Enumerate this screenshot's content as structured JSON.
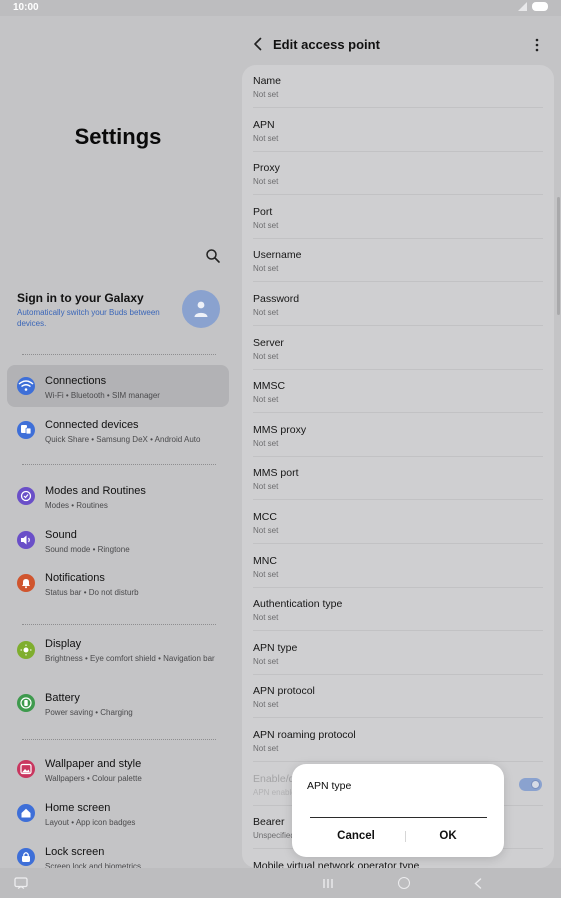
{
  "status_bar": {
    "time": "10:00"
  },
  "left_pane": {
    "title": "Settings",
    "account": {
      "title": "Sign in to your Galaxy",
      "subtitle": "Automatically switch your Buds between devices."
    },
    "menu_groups": [
      [
        {
          "label": "Connections",
          "sub": "Wi-Fi  •  Bluetooth  •  SIM manager",
          "icon": "wifi-icon",
          "color": "#3e6fd8",
          "selected": true
        },
        {
          "label": "Connected devices",
          "sub": "Quick Share  •  Samsung DeX  •  Android Auto",
          "icon": "connected-devices-icon",
          "color": "#3e6fd8"
        }
      ],
      [
        {
          "label": "Modes and Routines",
          "sub": "Modes  •  Routines",
          "icon": "modes-icon",
          "color": "#6a4fc8"
        },
        {
          "label": "Sound",
          "sub": "Sound mode  •  Ringtone",
          "icon": "sound-icon",
          "color": "#6a4fc8"
        },
        {
          "label": "Notifications",
          "sub": "Status bar  •  Do not disturb",
          "icon": "notifications-icon",
          "color": "#d0552e"
        }
      ],
      [
        {
          "label": "Display",
          "sub": "Brightness  •  Eye comfort shield  •  Navigation bar",
          "icon": "display-icon",
          "color": "#7fae2e"
        },
        {
          "label": "Battery",
          "sub": "Power saving  •  Charging",
          "icon": "battery-icon",
          "color": "#3e9a4d"
        }
      ],
      [
        {
          "label": "Wallpaper and style",
          "sub": "Wallpapers  •  Colour palette",
          "icon": "wallpaper-icon",
          "color": "#c9365f"
        },
        {
          "label": "Home screen",
          "sub": "Layout  •  App icon badges",
          "icon": "home-screen-icon",
          "color": "#3e6fd8"
        },
        {
          "label": "Lock screen",
          "sub": "Screen lock and biometrics",
          "icon": "lock-icon",
          "color": "#3e6fd8"
        }
      ]
    ]
  },
  "right_pane": {
    "title": "Edit access point",
    "fields": [
      {
        "label": "Name",
        "value": "Not set"
      },
      {
        "label": "APN",
        "value": "Not set"
      },
      {
        "label": "Proxy",
        "value": "Not set"
      },
      {
        "label": "Port",
        "value": "Not set"
      },
      {
        "label": "Username",
        "value": "Not set"
      },
      {
        "label": "Password",
        "value": "Not set"
      },
      {
        "label": "Server",
        "value": "Not set"
      },
      {
        "label": "MMSC",
        "value": "Not set"
      },
      {
        "label": "MMS proxy",
        "value": "Not set"
      },
      {
        "label": "MMS port",
        "value": "Not set"
      },
      {
        "label": "MCC",
        "value": "Not set"
      },
      {
        "label": "MNC",
        "value": "Not set"
      },
      {
        "label": "Authentication type",
        "value": "Not set"
      },
      {
        "label": "APN type",
        "value": "Not set"
      },
      {
        "label": "APN protocol",
        "value": "Not set"
      },
      {
        "label": "APN roaming protocol",
        "value": "Not set"
      },
      {
        "label": "Enable/disable APN",
        "value": "APN enabled",
        "dim": true,
        "toggle": true
      },
      {
        "label": "Bearer",
        "value": "Unspecified"
      },
      {
        "label": "Mobile virtual network operator type",
        "value": ""
      }
    ]
  },
  "dialog": {
    "title": "APN type",
    "input_value": "",
    "cancel_label": "Cancel",
    "ok_label": "OK"
  }
}
